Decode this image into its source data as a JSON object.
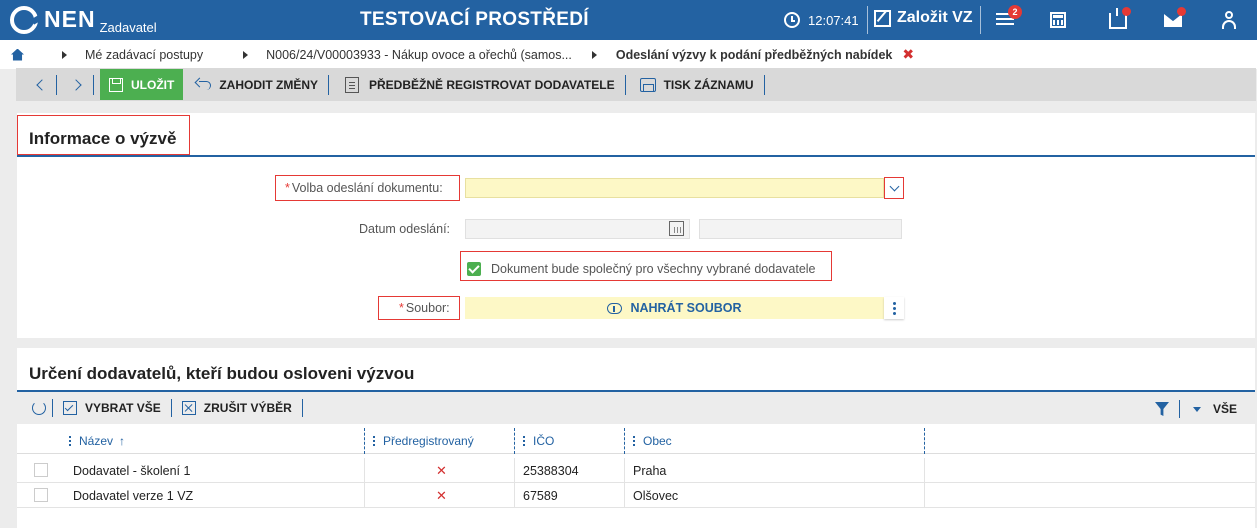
{
  "app": {
    "logo": "NEN",
    "logo_sub": "Zadavatel",
    "environment": "TESTOVACÍ PROSTŘEDÍ"
  },
  "topbar": {
    "time": "12:07:41",
    "create_label": "Založit VZ",
    "notifications_count": "2",
    "icons": [
      "clock-icon",
      "edit-icon",
      "menu-icon",
      "calculator-icon",
      "inbox-icon",
      "mail-icon",
      "user-icon"
    ]
  },
  "breadcrumb": {
    "items": [
      "Mé zadávací postupy",
      "N006/24/V00003933 - Nákup ovoce a ořechů (samos..."
    ],
    "current": "Odeslání výzvy k podání předběžných nabídek",
    "close_symbol": "✖"
  },
  "toolbar": {
    "save_label": "ULOŽIT",
    "discard_label": "ZAHODIT ZMĚNY",
    "preregister_label": "PŘEDBĚŽNĚ REGISTROVAT DODAVATELE",
    "print_label": "TISK ZÁZNAMU"
  },
  "info_panel": {
    "title": "Informace o výzvě",
    "send_option_label": "Volba odeslání dokumentu:",
    "send_option_value": "",
    "date_label": "Datum odeslání:",
    "date_value": "",
    "shared_doc_label": "Dokument bude společný pro všechny vybrané dodavatele",
    "shared_doc_checked": true,
    "file_label": "Soubor:",
    "upload_label": "NAHRÁT SOUBOR",
    "required_mark": "*"
  },
  "suppliers_panel": {
    "title": "Určení dodavatelů, kteří budou osloveni výzvou",
    "select_all_label": "VYBRAT VŠE",
    "unselect_label": "ZRUŠIT VÝBĚR",
    "all_label": "VŠE",
    "columns": [
      "Název",
      "Předregistrovaný",
      "IČO",
      "Obec"
    ],
    "sort_indicator": "↑",
    "rows": [
      {
        "name": "Dodavatel - školení 1",
        "preregistered": "✕",
        "ico": "25388304",
        "city": "Praha"
      },
      {
        "name": "Dodavatel verze 1 VZ",
        "preregistered": "✕",
        "ico": "67589",
        "city": "Olšovec"
      }
    ]
  },
  "colors": {
    "brand": "#2362a2",
    "save": "#4caf50",
    "required": "#e53935",
    "highlight_field": "#fdf8c6"
  }
}
